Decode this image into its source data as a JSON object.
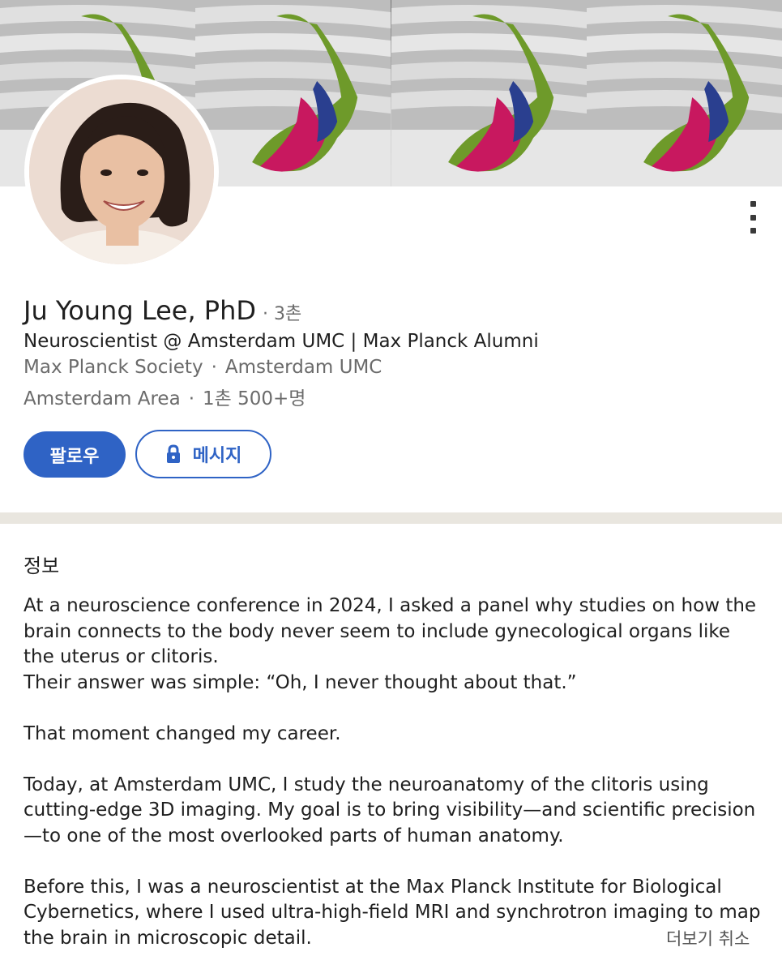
{
  "profile": {
    "name": "Ju Young Lee, PhD",
    "degree_separator": "·",
    "degree": "3촌",
    "headline": "Neuroscientist @ Amsterdam UMC | Max Planck Alumni",
    "org1": "Max Planck Society",
    "org2": "Amsterdam UMC",
    "location": "Amsterdam Area",
    "connections": "1촌 500+명",
    "dot": "·"
  },
  "actions": {
    "follow_label": "팔로우",
    "message_label": "메시지"
  },
  "about": {
    "title": "정보",
    "p1_l1": "At a neuroscience conference in 2024, I asked a panel why studies on how the brain connects to the body never seem to include gynecological organs like the uterus or clitoris.",
    "p1_l2": "Their answer was simple: “Oh, I never thought about that.”",
    "p2": "That moment changed my career.",
    "p3": "Today, at Amsterdam UMC, I study the neuroanatomy of the clitoris using cutting-edge 3D imaging. My goal is to bring visibility—and scientific precision—to one of the most overlooked parts of human anatomy.",
    "p4": "Before this, I was a neuroscientist at the Max Planck Institute for Biological Cybernetics, where I used ultra-high-field MRI and synchrotron imaging to map the brain in microscopic detail.",
    "see_less": "더보기 취소"
  },
  "icons": {
    "more": "more-vertical-icon",
    "lock": "lock-icon"
  },
  "colors": {
    "primary": "#2f63c5",
    "divider": "#e9e6df",
    "muted_text": "#6b6b6b"
  }
}
